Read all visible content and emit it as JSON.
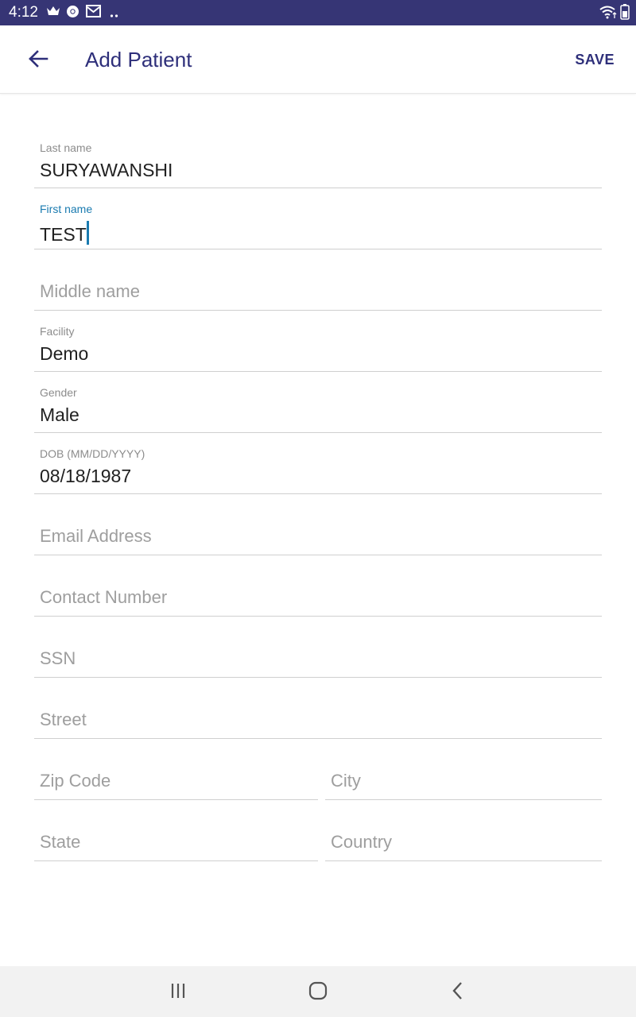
{
  "status_bar": {
    "time": "4:12",
    "left_icons": [
      "crown-icon",
      "chrome-icon",
      "gmail-icon",
      "more-dots-icon"
    ],
    "right_icons": [
      "wifi-icon",
      "battery-icon"
    ]
  },
  "app_bar": {
    "title": "Add Patient",
    "save_label": "SAVE"
  },
  "form": {
    "last_name": {
      "label": "Last name",
      "value": "SURYAWANSHI"
    },
    "first_name": {
      "label": "First name",
      "value": "TEST"
    },
    "middle_name": {
      "placeholder": "Middle name"
    },
    "facility": {
      "label": "Facility",
      "value": "Demo"
    },
    "gender": {
      "label": "Gender",
      "value": "Male"
    },
    "dob": {
      "label": "DOB (MM/DD/YYYY)",
      "value": "08/18/1987"
    },
    "email": {
      "placeholder": "Email Address"
    },
    "contact": {
      "placeholder": "Contact Number"
    },
    "ssn": {
      "placeholder": "SSN"
    },
    "street": {
      "placeholder": "Street"
    },
    "zip": {
      "placeholder": "Zip Code"
    },
    "city": {
      "placeholder": "City"
    },
    "state": {
      "placeholder": "State"
    },
    "country": {
      "placeholder": "Country"
    }
  },
  "colors": {
    "status_bar": "#363575",
    "accent": "#2e2f7a",
    "focus": "#1a7bb0"
  }
}
